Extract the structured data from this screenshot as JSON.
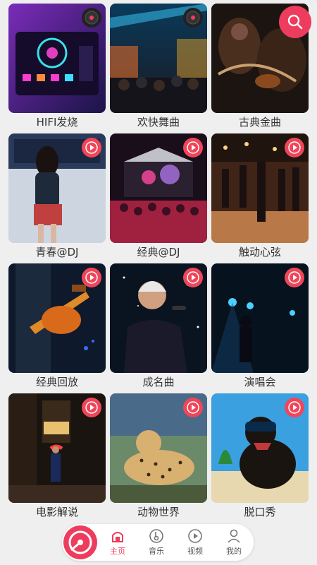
{
  "tiles": [
    {
      "title": "HIFI发烧"
    },
    {
      "title": "欢快舞曲"
    },
    {
      "title": "古典金曲"
    },
    {
      "title": "青春@DJ"
    },
    {
      "title": "经典@DJ"
    },
    {
      "title": "触动心弦"
    },
    {
      "title": "经典回放"
    },
    {
      "title": "成名曲"
    },
    {
      "title": "演唱会"
    },
    {
      "title": "电影解说"
    },
    {
      "title": "动物世界"
    },
    {
      "title": "脱口秀"
    }
  ],
  "tabbar": {
    "home": "主页",
    "music": "音乐",
    "video": "视频",
    "mine": "我的"
  },
  "colors": {
    "accent": "#ee3c5e",
    "background": "#efefef"
  }
}
